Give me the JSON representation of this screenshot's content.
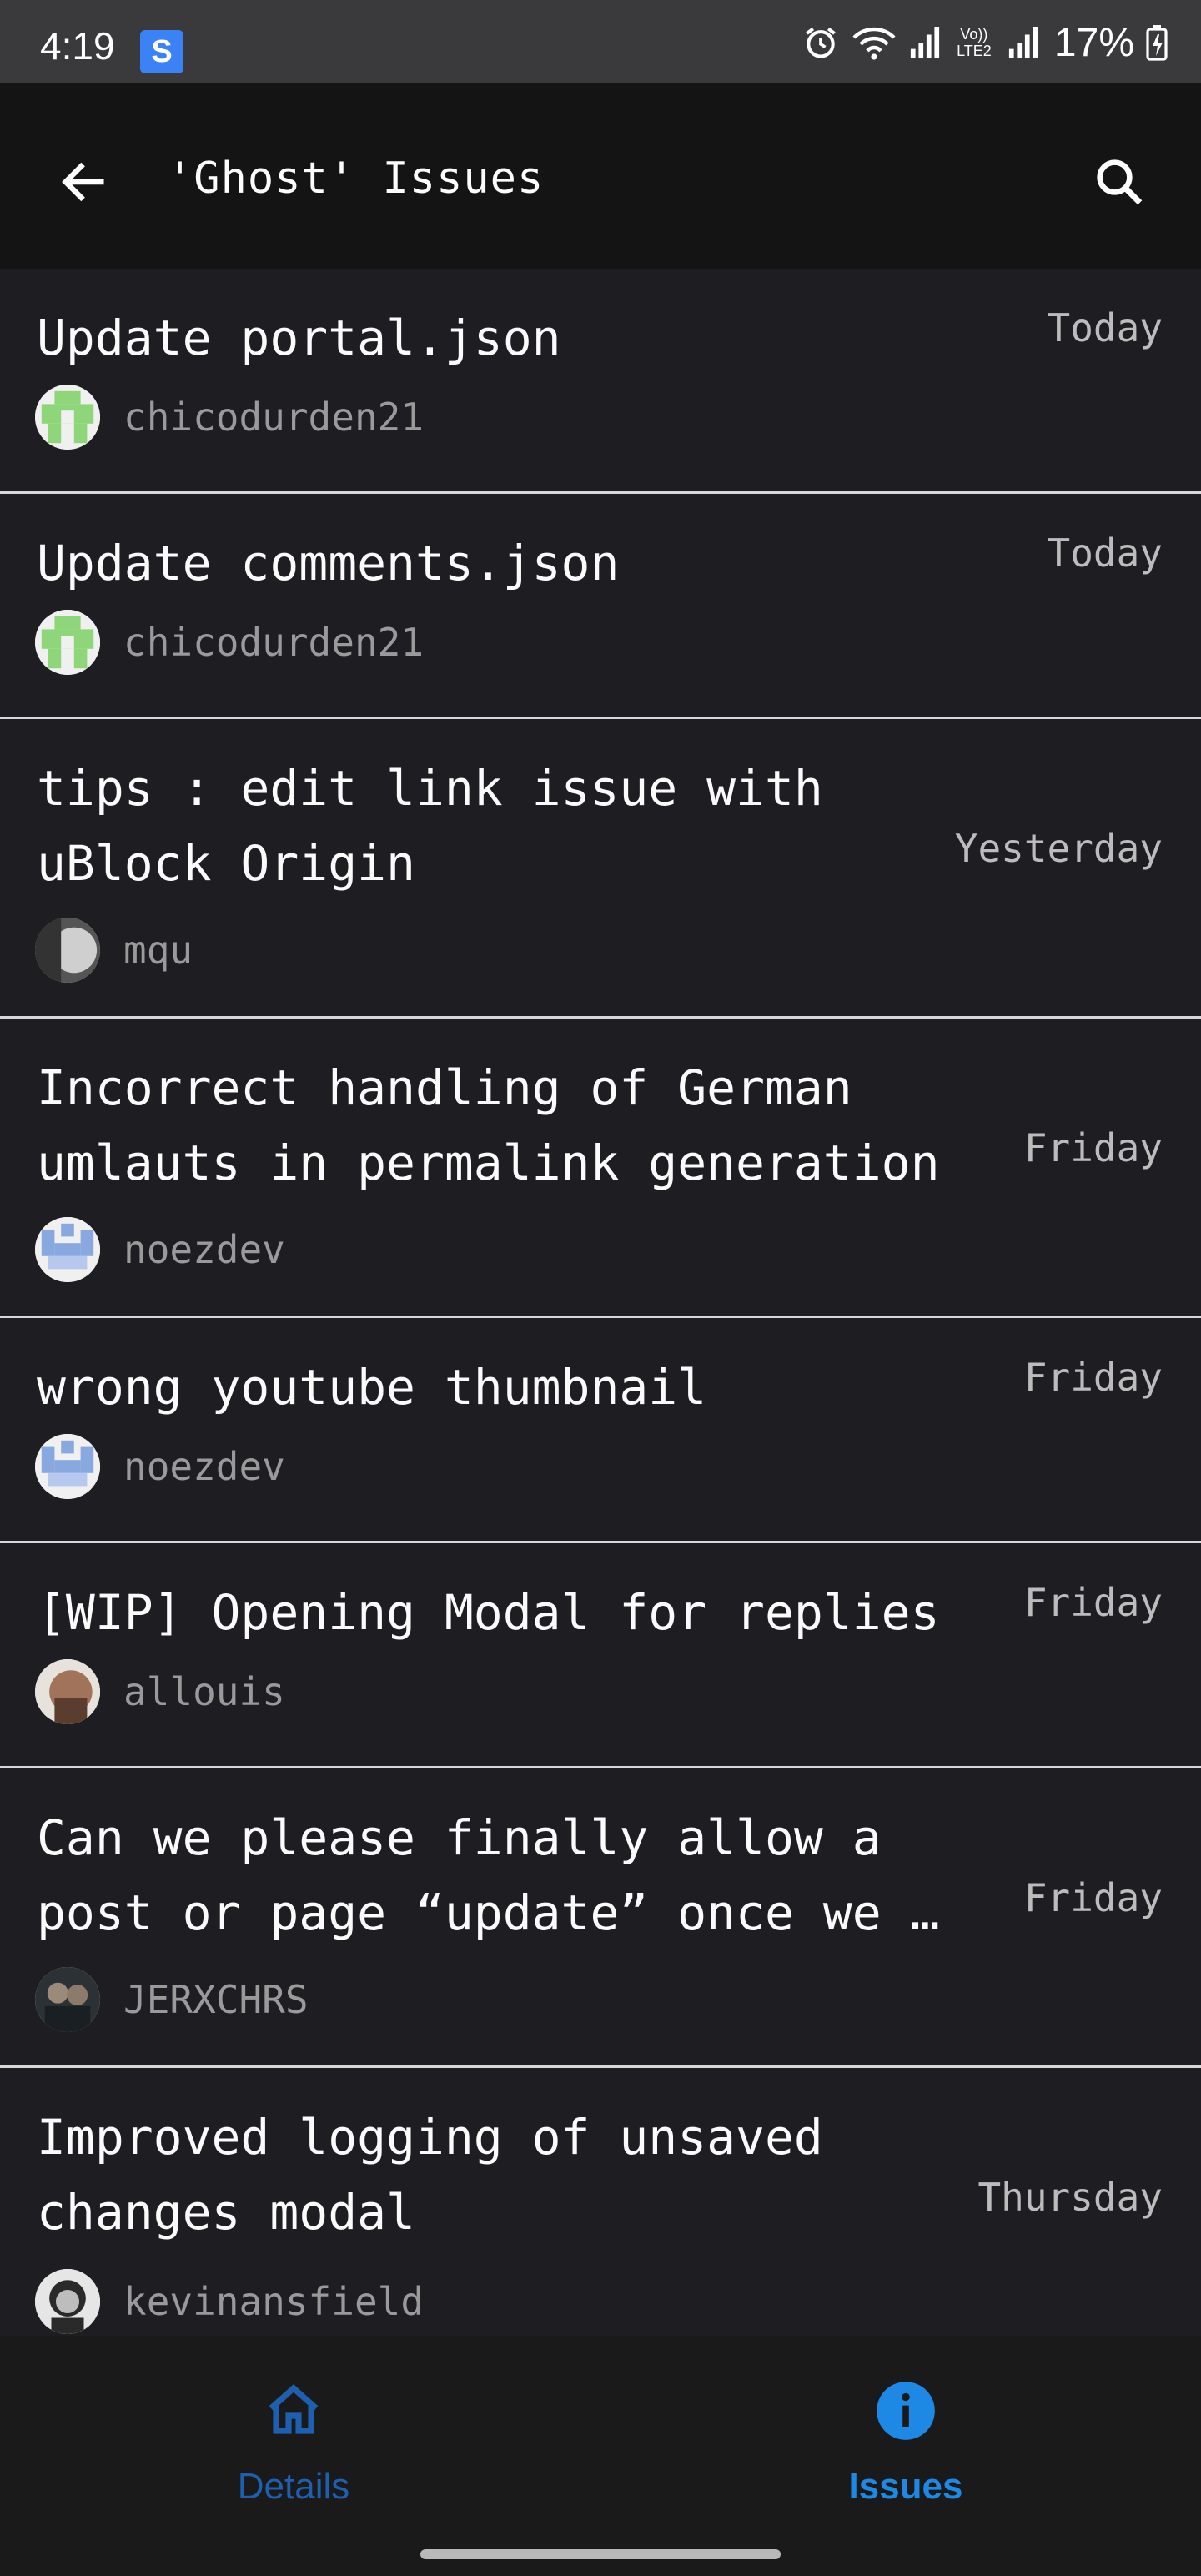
{
  "status_bar": {
    "time": "4:19",
    "app_icon_letter": "S",
    "battery_percent": "17%",
    "network_label": "Vo)) LTE2"
  },
  "app_bar": {
    "title": "'Ghost' Issues",
    "back_icon": "arrow-left-icon",
    "search_icon": "search-icon"
  },
  "issues": [
    {
      "title": "Update portal.json",
      "date": "Today",
      "author": "chicodurden21",
      "avatar": "green-identicon"
    },
    {
      "title": "Update comments.json",
      "date": "Today",
      "author": "chicodurden21",
      "avatar": "green-identicon"
    },
    {
      "title": "tips : edit link issue with\nuBlock Origin",
      "date": "Yesterday",
      "author": "mqu",
      "avatar": "photo-bw"
    },
    {
      "title": "Incorrect handling of German\numlauts in permalink generation",
      "date": "Friday",
      "author": "noezdev",
      "avatar": "blue-identicon"
    },
    {
      "title": "wrong youtube thumbnail",
      "date": "Friday",
      "author": "noezdev",
      "avatar": "blue-identicon"
    },
    {
      "title": "[WIP] Opening Modal for replies",
      "date": "Friday",
      "author": "allouis",
      "avatar": "photo-face"
    },
    {
      "title": "Can we please finally allow a\npost or page “update” once we …",
      "date": "Friday",
      "author": "JERXCHRS",
      "avatar": "photo-group"
    },
    {
      "title": "Improved logging of unsaved\nchanges modal",
      "date": "Thursday",
      "author": "kevinansfield",
      "avatar": "photo-bw2"
    }
  ],
  "bottom_nav": {
    "details_label": "Details",
    "issues_label": "Issues",
    "active": "Issues"
  },
  "colors": {
    "background": "#1e1d22",
    "accent": "#1e88e5",
    "divider": "#d7d7d7"
  }
}
